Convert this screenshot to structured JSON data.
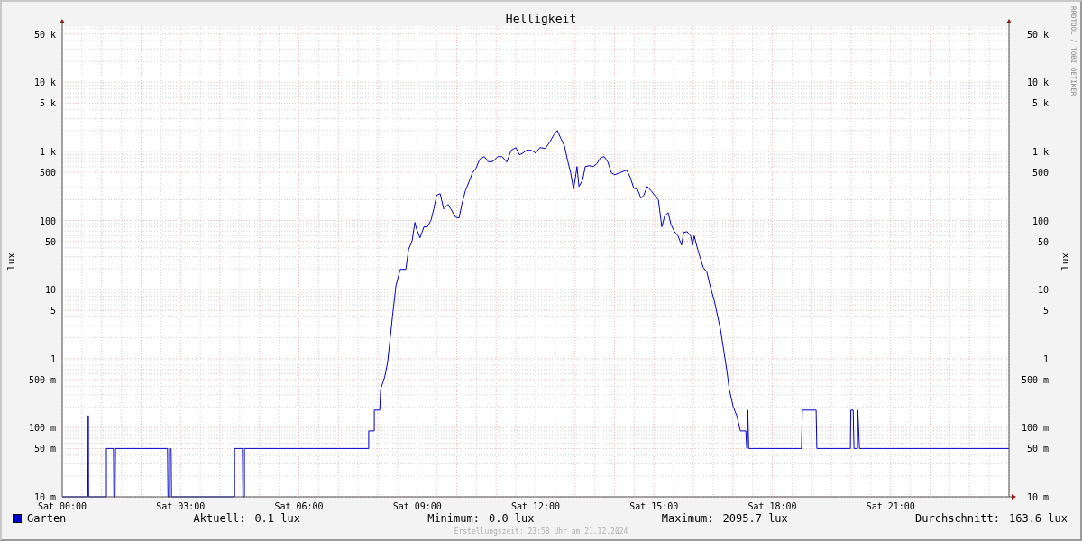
{
  "graph": {
    "title": "Helligkeit",
    "left_axis": {
      "label": "lux",
      "ticks": [
        "50 k",
        "10 k",
        "5 k",
        "1 k",
        "500",
        "100",
        "50",
        "10",
        "5",
        "1",
        "500 m",
        "100 m",
        "50 m",
        "10 m"
      ]
    },
    "right_axis": {
      "label": "lux",
      "ticks": [
        "50 k",
        "10 k",
        "5 k",
        "1 k",
        "500",
        "100",
        "50",
        "10",
        "5",
        "1",
        "500 m",
        "100 m",
        "50 m",
        "10 m"
      ]
    },
    "x_axis": {
      "ticks": [
        "Sat 00:00",
        "Sat 03:00",
        "Sat 06:00",
        "Sat 09:00",
        "Sat 12:00",
        "Sat 15:00",
        "Sat 18:00",
        "Sat 21:00"
      ]
    },
    "credit": "RRDTOOL / TOBI OETIKER"
  },
  "legend": {
    "series": {
      "name": "Garten",
      "color": "#0000cc"
    },
    "stats": [
      {
        "label": "Aktuell:",
        "value": "0.1 lux"
      },
      {
        "label": "Minimum:",
        "value": "0.0 lux"
      },
      {
        "label": "Maximum:",
        "value": "2095.7 lux"
      },
      {
        "label": "Durchschnitt:",
        "value": "163.6 lux"
      }
    ]
  },
  "footer": "Erstellungszeit: 23:58 Uhr am 21.12.2024"
}
